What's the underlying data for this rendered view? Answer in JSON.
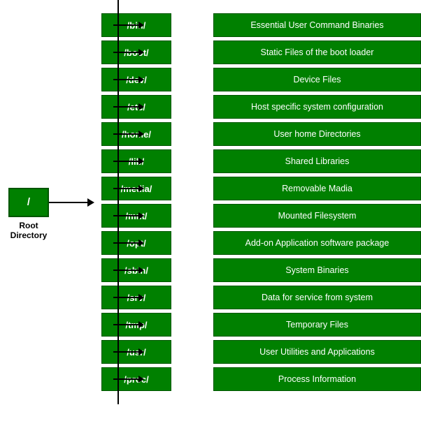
{
  "root": {
    "label": "/",
    "sublabel": "Root\nDirectory"
  },
  "rows": [
    {
      "dir": "/bin/",
      "desc": "Essential User Command Binaries"
    },
    {
      "dir": "/boot/",
      "desc": "Static Files of the boot loader"
    },
    {
      "dir": "/dev/",
      "desc": "Device Files"
    },
    {
      "dir": "/etc/",
      "desc": "Host specific system configuration"
    },
    {
      "dir": "/home/",
      "desc": "User home Directories"
    },
    {
      "dir": "/lib/",
      "desc": "Shared Libraries"
    },
    {
      "dir": "/media/",
      "desc": "Removable Madia"
    },
    {
      "dir": "/mnt/",
      "desc": "Mounted Filesystem"
    },
    {
      "dir": "/opt/",
      "desc": "Add-on Application software package"
    },
    {
      "dir": "/sbin/",
      "desc": "System Binaries"
    },
    {
      "dir": "/srv/",
      "desc": "Data for service from system"
    },
    {
      "dir": "/tmp/",
      "desc": "Temporary Files"
    },
    {
      "dir": "/usr/",
      "desc": "User Utilities and Applications"
    },
    {
      "dir": "/proc/",
      "desc": "Process Information"
    }
  ]
}
